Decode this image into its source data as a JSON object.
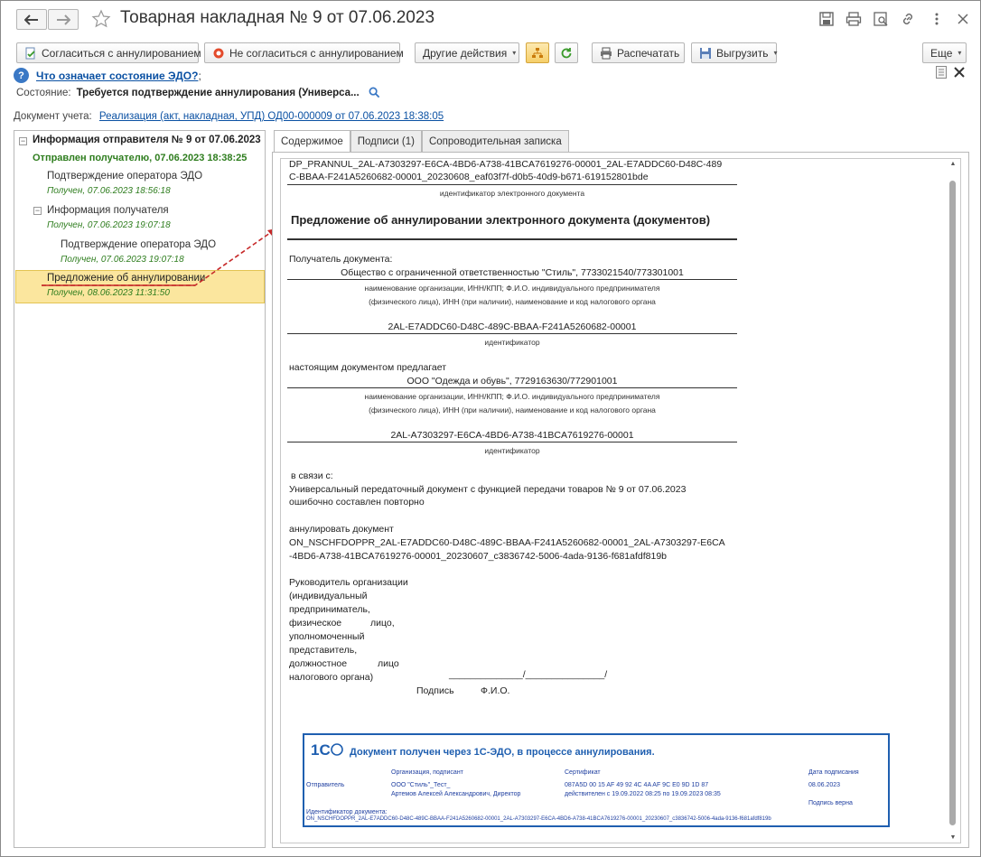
{
  "window": {
    "title": "Товарная накладная № 9 от 07.06.2023"
  },
  "toolbar": {
    "agree": "Согласиться с аннулированием",
    "disagree": "Не согласиться с аннулированием",
    "other": "Другие действия",
    "print": "Распечатать",
    "export": "Выгрузить",
    "more": "Еще"
  },
  "help": {
    "link": "Что означает состояние ЭДО?",
    "semicolon": ";"
  },
  "state": {
    "label": "Состояние:",
    "value": "Требуется подтверждение аннулирования (Универса..."
  },
  "doc": {
    "label": "Документ учета:",
    "link": "Реализация (акт, накладная, УПД) ОД00-000009 от 07.06.2023 18:38:05"
  },
  "tree": {
    "n1": "Информация отправителя № 9 от 07.06.2023",
    "n1_sub": "Отправлен получателю, 07.06.2023 18:38:25",
    "n2": "Подтверждение оператора ЭДО",
    "n2_sub": "Получен, 07.06.2023 18:56:18",
    "n3": "Информация получателя",
    "n3_sub": "Получен, 07.06.2023 19:07:18",
    "n4": "Подтверждение оператора ЭДО",
    "n4_sub": "Получен, 07.06.2023 19:07:18",
    "n5": "Предложение об аннулировании",
    "n5_sub": "Получен, 08.06.2023 11:31:50"
  },
  "tabs": [
    "Содержимое",
    "Подписи (1)",
    "Сопроводительная записка"
  ],
  "document": {
    "file_id_1": "DP_PRANNUL_2AL-A7303297-E6CA-4BD6-A738-41BCA7619276-00001_2AL-E7ADDC60-D48C-489",
    "file_id_2": "C-BBAA-F241A5260682-00001_20230608_eaf03f7f-d0b5-40d9-b671-619152801bde",
    "file_id_caption": "идентификатор электронного документа",
    "heading": "Предложение об аннулировании электронного документа (документов)",
    "recipient_label": "Получатель документа:",
    "recipient": "Общество с ограниченной ответственностью \"Стиль\", 7733021540/773301001",
    "org_caption_1": "наименование организации, ИНН/КПП; Ф.И.О. индивидуального предпринимателя",
    "org_caption_2": "(физического лица), ИНН (при наличии), наименование и код налогового органа",
    "recipient_id": "2AL-E7ADDC60-D48C-489C-BBAA-F241A5260682-00001",
    "id_caption": "идентификатор",
    "proposes_label": "настоящим документом предлагает",
    "sender": "ООО \"Одежда и обувь\", 7729163630/772901001",
    "sender_id": "2AL-A7303297-E6CA-4BD6-A738-41BCA7619276-00001",
    "reason_label": "в связи с:",
    "reason_1": "Универсальный передаточный документ с функцией передачи товаров  № 9 от 07.06.2023",
    "reason_2": "ошибочно составлен повторно",
    "annul_label": "аннулировать документ",
    "annul_1": "ON_NSCHFDOPPR_2AL-E7ADDC60-D48C-489C-BBAA-F241A5260682-00001_2AL-A7303297-E6CA",
    "annul_2": "-4BD6-A738-41BCA7619276-00001_20230607_c3836742-5006-4ada-9136-f681afdf819b",
    "head_1": "Руководитель  организации",
    "head_2": "(индивидуальный",
    "head_3": "предприниматель,",
    "head_4a": "физическое",
    "head_4b": "лицо,",
    "head_5": "уполномоченный",
    "head_6": "представитель,",
    "head_7a": "должностное",
    "head_7b": "лицо",
    "head_8": "налогового органа)",
    "sign_line": "______________/_______________/",
    "sign_caption": "Подпись",
    "fio_caption": "Ф.И.О."
  },
  "stamp": {
    "logo": "1С",
    "header": "Документ получен через 1С-ЭДО, в процессе аннулирования.",
    "col_org": "Организация, подписант",
    "col_cert": "Сертификат",
    "col_date": "Дата подписания",
    "row_label": "Отправитель",
    "org_1": "ООО \"Стиль\"_Тест_",
    "org_2": "Артемов Алексей Александрович, Директор",
    "cert_1": "087A5D 00 15 AF 49 92 4C 4A AF 9C E0 9D 1D 87",
    "cert_2": "действителен с 19.09.2022 08:25 по 19.09.2023 08:35",
    "date": "08.06.2023",
    "sign_ok": "Подпись верна",
    "id_label": "Идентификатор документа:",
    "id_value": "ON_NSCHFDOPPR_2AL-E7ADDC60-D48C-489C-BBAA-F241A5260682-00001_2AL-A7303297-E6CA-4BD6-A738-41BCA7619276-00001_20230607_c3836742-5006-4ada-9136-f681afdf819b"
  },
  "colors": {
    "accent": "#0b51a3",
    "selected_row": "#fbe69e",
    "status_green": "#2e7d1e",
    "arrow_red": "#c62828"
  }
}
